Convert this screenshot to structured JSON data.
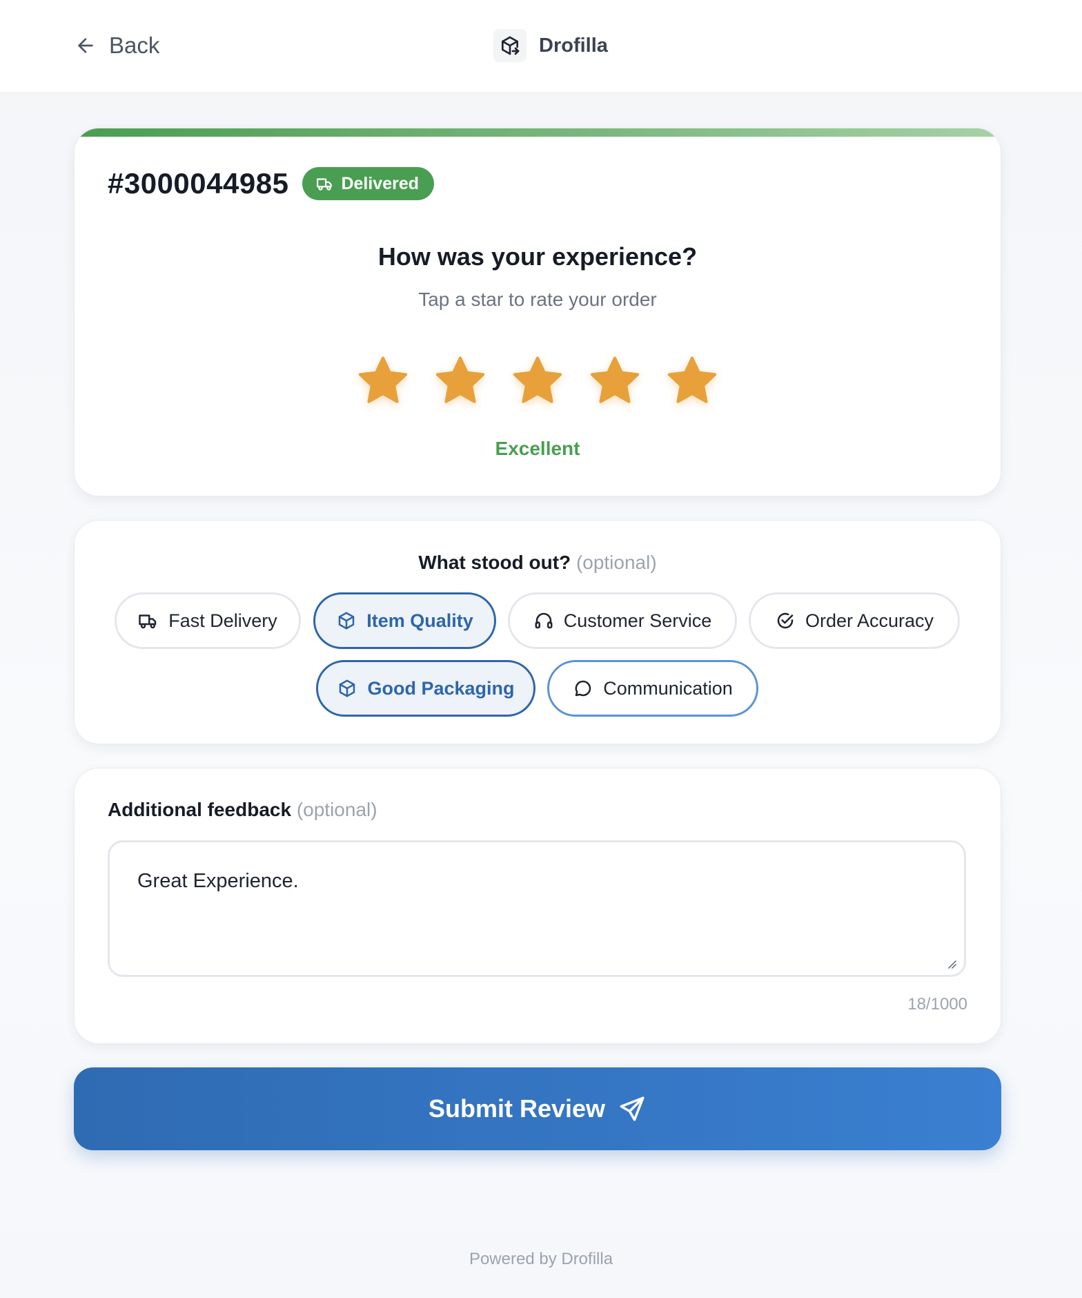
{
  "header": {
    "back_label": "Back",
    "brand_name": "Drofilla"
  },
  "order": {
    "number": "#3000044985",
    "status": "Delivered",
    "status_color": "#4a9e51"
  },
  "rating": {
    "title": "How was your experience?",
    "subtitle": "Tap a star to rate your order",
    "value": 5,
    "max": 5,
    "label": "Excellent",
    "star_color": "#e8a03a"
  },
  "highlights": {
    "title": "What stood out?",
    "optional": "(optional)",
    "chips": [
      {
        "label": "Fast Delivery",
        "icon": "truck-icon",
        "selected": false
      },
      {
        "label": "Item Quality",
        "icon": "box-icon",
        "selected": true
      },
      {
        "label": "Customer Service",
        "icon": "headphones-icon",
        "selected": false
      },
      {
        "label": "Order Accuracy",
        "icon": "check-circle-icon",
        "selected": false
      },
      {
        "label": "Good Packaging",
        "icon": "box-icon",
        "selected": true
      },
      {
        "label": "Communication",
        "icon": "chat-bubble-icon",
        "selected": false,
        "focused": true
      }
    ]
  },
  "feedback": {
    "title": "Additional feedback",
    "optional": "(optional)",
    "value": "Great Experience.",
    "counter": "18/1000"
  },
  "submit": {
    "label": "Submit Review"
  },
  "footer": {
    "text": "Powered by Drofilla"
  },
  "colors": {
    "primary": "#2f6bb3",
    "success": "#4a9e51",
    "star": "#e8a03a"
  }
}
